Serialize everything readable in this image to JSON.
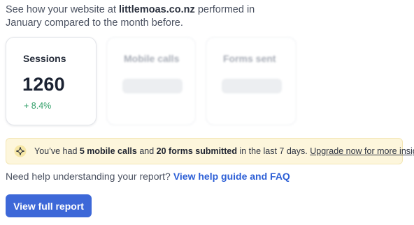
{
  "intro": {
    "prefix": "See how your website at ",
    "domain": "littlemoas.co.nz",
    "suffix": " performed in January compared to the month before."
  },
  "cards": [
    {
      "title": "Sessions",
      "value": "1260",
      "delta": "+ 8.4%",
      "blurred": false
    },
    {
      "title": "Mobile calls",
      "blurred": true
    },
    {
      "title": "Forms sent",
      "blurred": true
    }
  ],
  "banner": {
    "icon": "sparkle-icon",
    "part1": "You’ve had ",
    "calls": "5 mobile calls",
    "part2": " and ",
    "forms": "20 forms submitted",
    "part3": " in the last 7 days. ",
    "link": "Upgrade now for more insights"
  },
  "help": {
    "text": "Need help understanding your report?",
    "link": "View help guide and FAQ"
  },
  "cta": {
    "label": "View full report"
  },
  "colors": {
    "accent": "#3d68d8",
    "link": "#2d5fd6",
    "positive": "#33a06a",
    "banner_bg": "#fdf6dc"
  }
}
